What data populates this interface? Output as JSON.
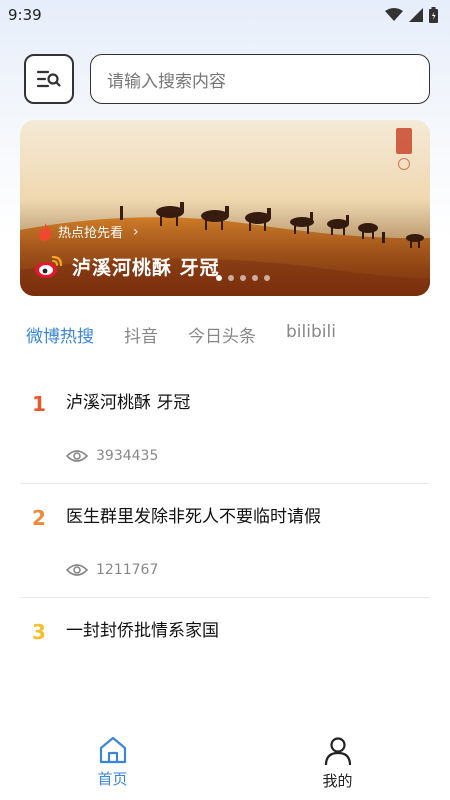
{
  "status_bar": {
    "time": "9:39",
    "icons": [
      "wifi-icon",
      "signal-icon",
      "battery-icon"
    ]
  },
  "search": {
    "placeholder": "请输入搜索内容",
    "menu_icon": "search-menu-icon"
  },
  "banner": {
    "tag": "热点抢先看",
    "title": "泸溪河桃酥 牙冠",
    "slide_count": 5,
    "active_slide": 0
  },
  "tabs": [
    {
      "label": "微博热搜",
      "active": true
    },
    {
      "label": "抖音",
      "active": false
    },
    {
      "label": "今日头条",
      "active": false
    },
    {
      "label": "bilibili",
      "active": false
    }
  ],
  "hot_list": [
    {
      "rank": "1",
      "title": "泸溪河桃酥 牙冠",
      "views": "3934435",
      "rank_color": "#e8582c"
    },
    {
      "rank": "2",
      "title": "医生群里发除非死人不要临时请假",
      "views": "1211767",
      "rank_color": "#f08a3a"
    },
    {
      "rank": "3",
      "title": "一封封侨批情系家国",
      "views": "",
      "rank_color": "#f4c02e"
    }
  ],
  "bottom_nav": [
    {
      "label": "首页",
      "icon": "home-icon",
      "active": true
    },
    {
      "label": "我的",
      "icon": "user-icon",
      "active": false
    }
  ],
  "colors": {
    "accent": "#3b86d8",
    "rank1": "#e8582c",
    "rank2": "#f08a3a",
    "rank3": "#f4c02e"
  }
}
